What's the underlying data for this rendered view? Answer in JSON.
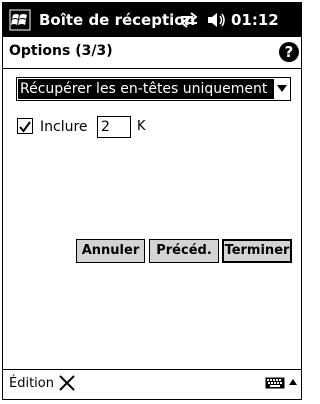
{
  "titlebar": {
    "title": "Boîte de réception",
    "clock": "01:12",
    "start_icon": "windows-flag-icon",
    "sync_icon": "sync-arrows-icon",
    "volume_icon": "speaker-icon"
  },
  "header": {
    "title": "Options (3/3)",
    "help_label": "?"
  },
  "download": {
    "selected": "Récupérer les en-têtes uniquement"
  },
  "include": {
    "label": "Inclure",
    "checked": true,
    "value": "2",
    "unit": "K"
  },
  "buttons": {
    "cancel": "Annuler",
    "previous": "Précéd.",
    "finish": "Terminer"
  },
  "menubar": {
    "edit": "Édition"
  },
  "colors": {
    "titlebar_bg": "#000000",
    "button_face": "#d4d4d4",
    "selection_bg": "#000000"
  }
}
